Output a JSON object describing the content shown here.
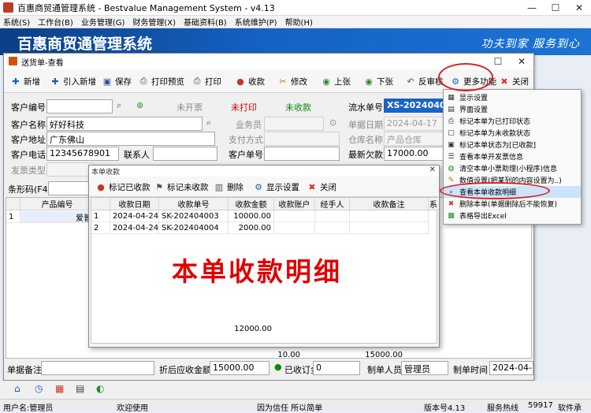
{
  "app": {
    "title": "百惠商贸通管理系统 - Bestvalue Management System - v4.13",
    "menu": [
      "系统(S)",
      "工作台(B)",
      "业务管理(G)",
      "财务管理(X)",
      "基础资料(B)",
      "系统维护(P)",
      "帮助(H)"
    ],
    "banner_title": "百惠商贸通管理系统",
    "banner_slogan": "功夫到家 服务到心",
    "win_min": "—",
    "win_max": "☐",
    "win_close": "✕"
  },
  "child": {
    "title": "送货单-查看",
    "win_max": "☐",
    "win_close": "✕",
    "toolbar": {
      "new": "新增",
      "ref_new": "引入新增",
      "save": "保存",
      "print_preview": "打印预览",
      "print": "打印",
      "receive": "收款",
      "edit": "修改",
      "prev": "上张",
      "next": "下张",
      "unaudit": "反审核",
      "more": "更多功能",
      "close": "关闭"
    },
    "form": {
      "customer_code_label": "客户编号",
      "customer_code": "",
      "customer_name_label": "客户名称",
      "customer_name": "好好科技",
      "customer_addr_label": "客户地址",
      "customer_addr": "广东佛山",
      "customer_phone_label": "客户电话",
      "customer_phone": "12345678901",
      "contact_label": "联系人",
      "contact": "",
      "invoice_type_label": "发票类型",
      "status_invoice": "未开票",
      "status_print": "未打印",
      "status_pay": "未收款",
      "salesman_label": "业务员",
      "pay_method_label": "支付方式",
      "customer_order_label": "客户单号",
      "serial_label": "流水单号",
      "serial": "XS-20240400",
      "date_label": "单据日期",
      "date": "2024-04-17",
      "warehouse_label": "仓库名称",
      "warehouse": "产品仓库",
      "latest_debt_label": "最新欠款",
      "latest_debt": "17000.00",
      "barcode_label": "条形码(F4)"
    },
    "grid": {
      "col_product": "产品编号",
      "row1_no": "1",
      "row1_product": "爱普",
      "total_qty": "10.00",
      "total_amount": "15000.00"
    },
    "footer": {
      "remark_label": "单据备注",
      "remark": "",
      "discount_label": "折后应收金额",
      "discount_value": "15000.00",
      "deposit_label": "已收订金",
      "deposit_value": "0",
      "maker_label": "制单人员",
      "maker": "管理员",
      "make_time_label": "制单时间",
      "make_time": "2024-04-17"
    }
  },
  "popup": {
    "title": "本单收款",
    "toolbar": {
      "mark_received": "标记已收款",
      "mark_unreceived": "标记未收款",
      "delete": "删除",
      "display_settings": "显示设置",
      "close": "关闭"
    },
    "columns": [
      "收款日期",
      "收款单号",
      "收款金额",
      "收款账户",
      "经手人",
      "收款备注",
      "系"
    ],
    "rows": [
      {
        "no": "1",
        "date": "2024-04-24",
        "code": "SK-202404003",
        "amount": "10000.00"
      },
      {
        "no": "2",
        "date": "2024-04-24",
        "code": "SK-202404004",
        "amount": "2000.00"
      }
    ],
    "total_amount": "12000.00",
    "overlay_text": "本单收款明细"
  },
  "dropdown": {
    "items": [
      "显示设置",
      "界面设置",
      "标记本单为已打印状态",
      "标记本单为未收款状态",
      "标记本单状态为[已收款]",
      "查看本单开发票信息",
      "清空本单小票助理(小程序)信息",
      "数值设置(把某列的内容设置为..)",
      "查看本单收款明细",
      "删除本单(单据删除后不能恢复)",
      "表格导出Excel"
    ],
    "highlighted_index": 8
  },
  "statusbar": {
    "user": "用户名:管理员",
    "welcome": "欢迎使用",
    "motto": "因为信任 所以简单",
    "version": "版本号4.13",
    "service_label": "服务热线",
    "service_no": "59917",
    "software": "软件承"
  },
  "colors": {
    "banner": "#1562c4",
    "accent_red": "#d62020",
    "status_green": "#0a8a00"
  }
}
